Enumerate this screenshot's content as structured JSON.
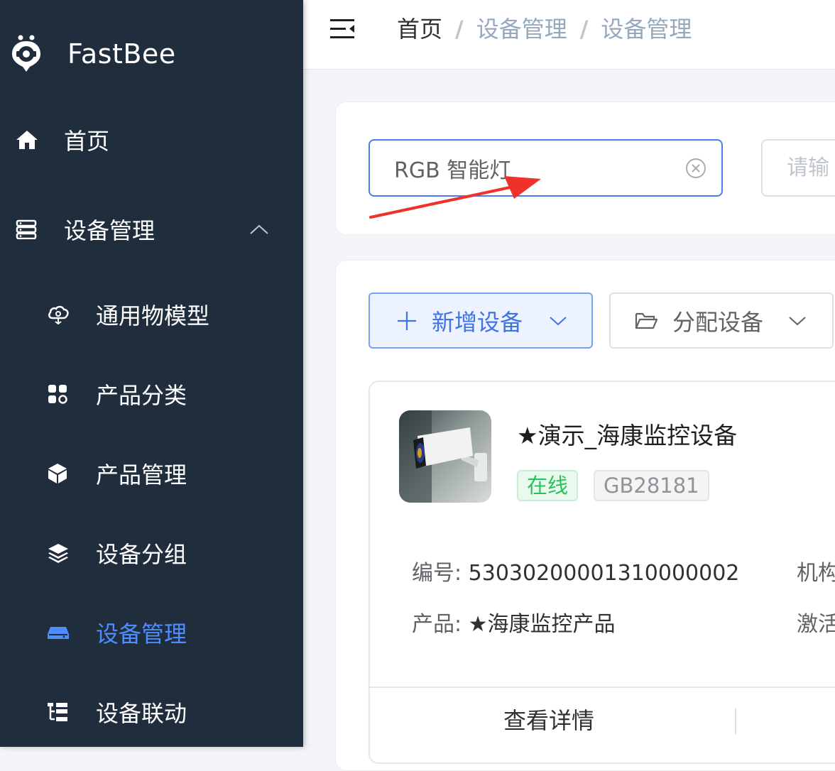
{
  "sidebar": {
    "brand": "FastBee",
    "items": [
      {
        "label": "首页",
        "icon": "home-icon",
        "level": "top"
      },
      {
        "label": "设备管理",
        "icon": "server-icon",
        "level": "top",
        "expanded": true
      },
      {
        "label": "通用物模型",
        "icon": "cloud-model-icon",
        "level": "sub"
      },
      {
        "label": "产品分类",
        "icon": "category-icon",
        "level": "sub"
      },
      {
        "label": "产品管理",
        "icon": "cube-icon",
        "level": "sub"
      },
      {
        "label": "设备分组",
        "icon": "layers-icon",
        "level": "sub"
      },
      {
        "label": "设备管理",
        "icon": "device-icon",
        "level": "sub",
        "active": true
      },
      {
        "label": "设备联动",
        "icon": "tree-icon",
        "level": "sub"
      }
    ]
  },
  "header": {
    "breadcrumb": [
      "首页",
      "设备管理",
      "设备管理"
    ]
  },
  "search": {
    "name_value": "RGB 智能灯",
    "second_placeholder": "请输"
  },
  "toolbar": {
    "add_label": "新增设备",
    "assign_label": "分配设备"
  },
  "device": {
    "name": "★演示_海康监控设备",
    "status": "在线",
    "protocol": "GB28181",
    "serial_label": "编号:",
    "serial": "53030200001310000002",
    "product_label": "产品:",
    "product": "★海康监控产品",
    "right_label_1": "机构",
    "right_label_2": "激活",
    "detail_button": "查看详情"
  },
  "colors": {
    "sidebar_bg": "#1f2d3d",
    "active": "#4f8cff",
    "primary": "#3f73e6",
    "online": "#29c25a",
    "annotation_arrow": "#f0302a"
  }
}
